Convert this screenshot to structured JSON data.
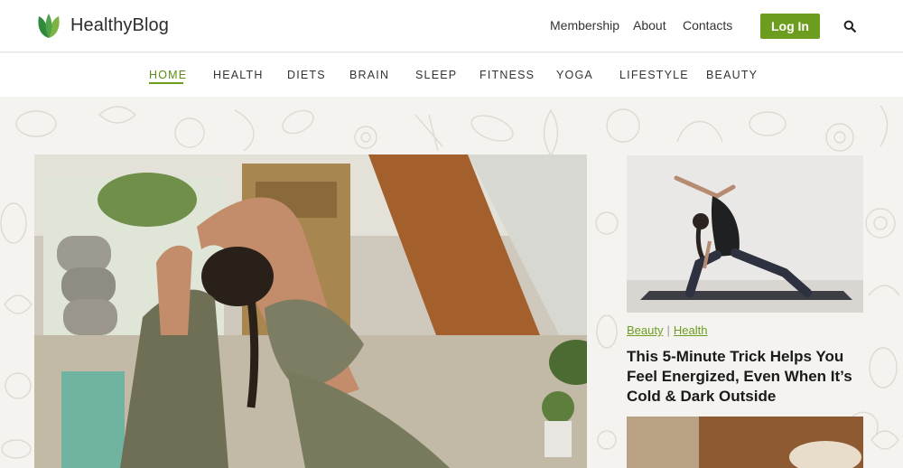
{
  "header": {
    "brand": "HealthyBlog",
    "nav": [
      {
        "label": "Membership"
      },
      {
        "label": "About"
      },
      {
        "label": "Contacts"
      }
    ],
    "login_label": "Log In",
    "accent_color": "#6c9d1f"
  },
  "categories": [
    {
      "label": "HOME",
      "active": true
    },
    {
      "label": "HEALTH"
    },
    {
      "label": "DIETS"
    },
    {
      "label": "BRAIN"
    },
    {
      "label": "SLEEP"
    },
    {
      "label": "FITNESS"
    },
    {
      "label": "YOGA"
    },
    {
      "label": "LIFESTYLE"
    },
    {
      "label": "BEAUTY"
    }
  ],
  "featured_card": {
    "tags": [
      "Beauty",
      "Health"
    ],
    "title_lines": [
      "This 5-Minute Trick Helps You",
      "Feel Energized, Even When It’s",
      "Cold & Dark Outside"
    ]
  },
  "icons": {
    "logo": "leaf-logo-icon",
    "search": "search-icon"
  }
}
